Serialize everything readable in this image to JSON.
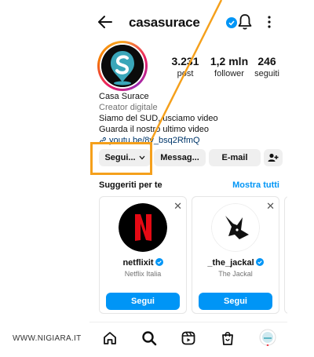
{
  "header": {
    "username": "casasurace"
  },
  "profile": {
    "stats": [
      {
        "value": "3.231",
        "label": "post"
      },
      {
        "value": "1,2 mln",
        "label": "follower"
      },
      {
        "value": "246",
        "label": "seguiti"
      }
    ],
    "name": "Casa Surace",
    "category": "Creator digitale",
    "bio_line1": "Siamo del SUD, usciamo video",
    "bio_line2": "Guarda il nostro ultimo video",
    "link": "youtu.be/8y_bsq2RfmQ"
  },
  "actions": {
    "follow": "Segui...",
    "message": "Messag...",
    "email": "E-mail"
  },
  "suggestions": {
    "title": "Suggeriti per te",
    "see_all": "Mostra tutti",
    "cards": [
      {
        "name": "netflixit",
        "subtitle": "Netflix Italia",
        "button": "Segui"
      },
      {
        "name": "_the_jackal",
        "subtitle": "The Jackal",
        "button": "Segui"
      }
    ]
  },
  "colors": {
    "accent_blue": "#0095f6",
    "highlight_orange": "#f5a01c",
    "netflix_red": "#e50914"
  },
  "watermark": "WWW.NIGIARA.IT"
}
